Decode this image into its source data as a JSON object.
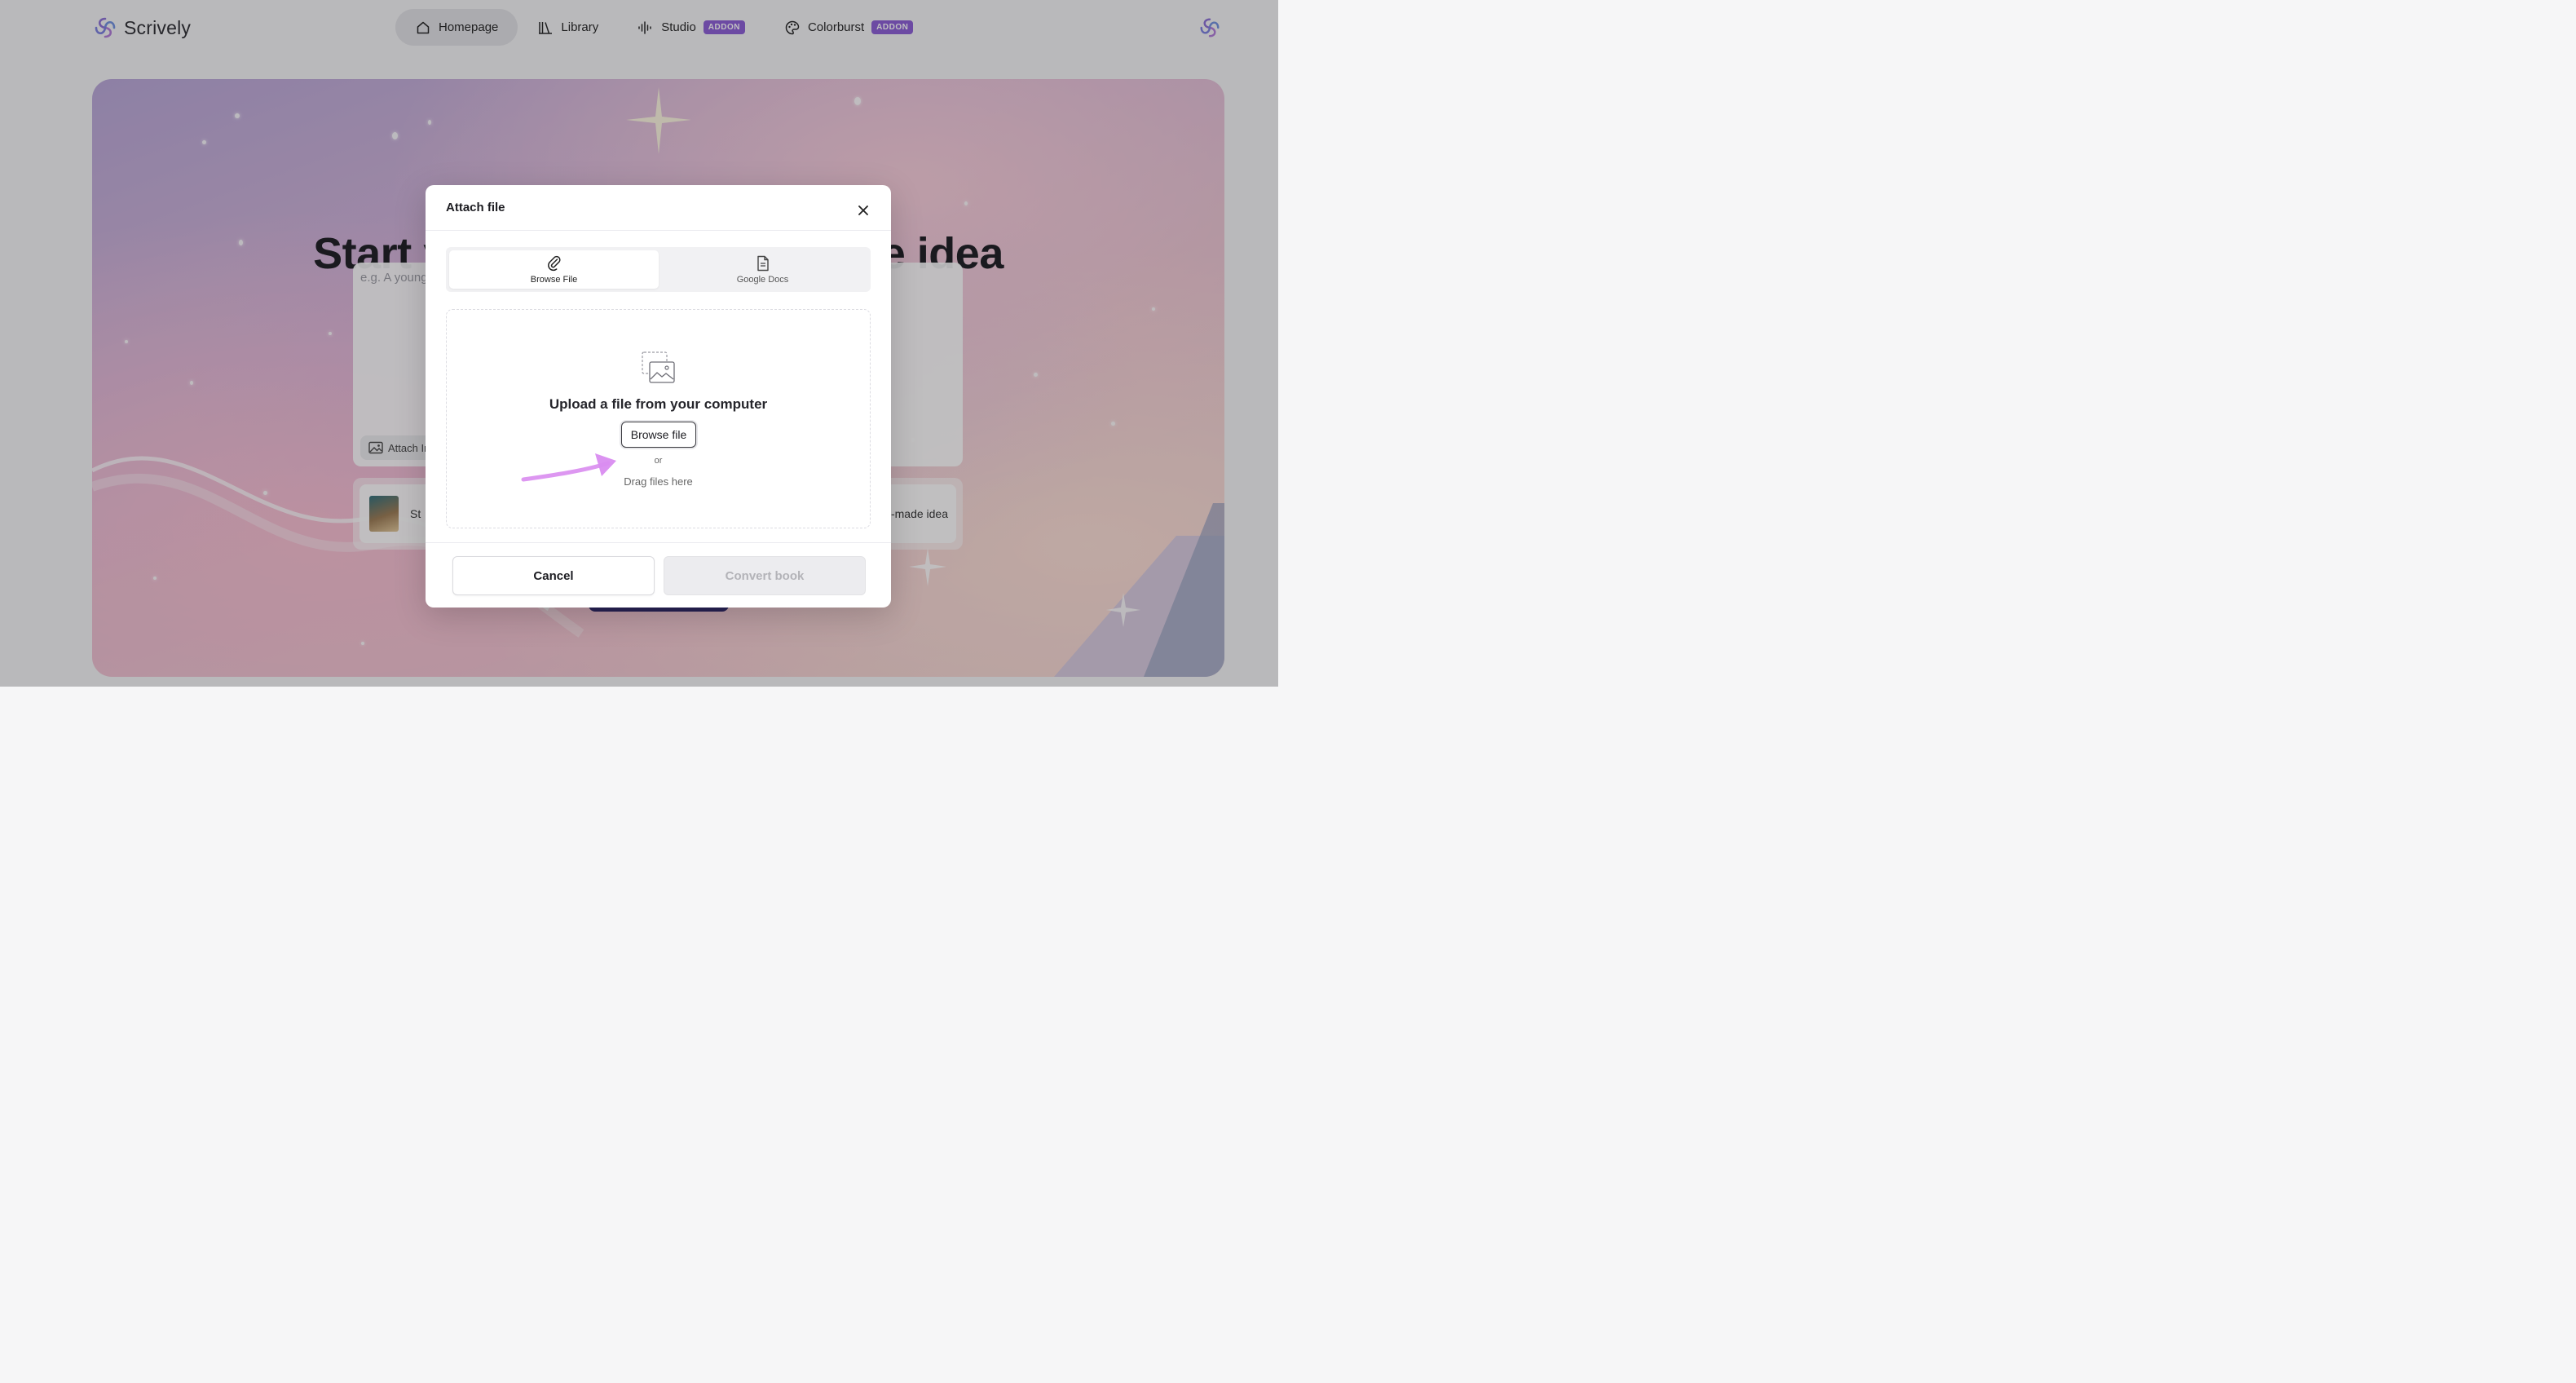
{
  "app": {
    "name": "Scrively",
    "accent_color": "#8b5cd6"
  },
  "nav": {
    "items": [
      {
        "label": "Homepage",
        "icon": "home-icon",
        "active": true
      },
      {
        "label": "Library",
        "icon": "library-icon"
      },
      {
        "label": "Studio",
        "icon": "audio-wave-icon",
        "badge": "ADDON"
      },
      {
        "label": "Colorburst",
        "icon": "palette-icon",
        "badge": "ADDON"
      }
    ]
  },
  "hero": {
    "title": "Start your story with a single idea",
    "prompt_placeholder": "e.g. A young",
    "attach_label": "Attach Ir",
    "idea_left_label": "St",
    "idea_right_label": "-made idea"
  },
  "modal": {
    "title": "Attach file",
    "tabs": [
      {
        "label": "Browse File",
        "icon": "paperclip-icon",
        "active": true
      },
      {
        "label": "Google Docs",
        "icon": "document-icon",
        "active": false
      }
    ],
    "dropzone": {
      "title": "Upload a file from your computer",
      "browse_label": "Browse file",
      "or_label": "or",
      "drag_label": "Drag files here"
    },
    "cancel_label": "Cancel",
    "convert_label": "Convert book",
    "convert_disabled": true
  }
}
